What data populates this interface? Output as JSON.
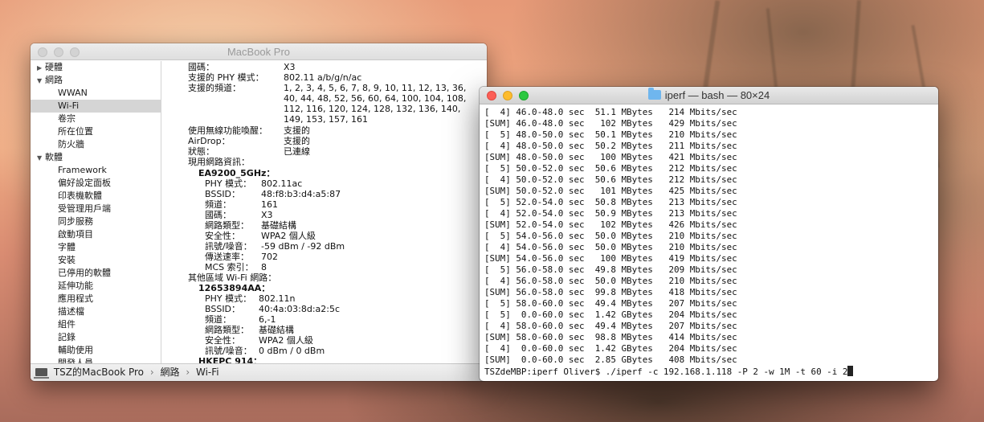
{
  "sysinfo": {
    "title": "MacBook Pro",
    "sidebar": [
      {
        "label": "硬體",
        "level": 0,
        "disclosure": "▶"
      },
      {
        "label": "網路",
        "level": 0,
        "disclosure": "▼"
      },
      {
        "label": "WWAN",
        "level": 1
      },
      {
        "label": "Wi-Fi",
        "level": 1,
        "selected": true
      },
      {
        "label": "卷宗",
        "level": 1
      },
      {
        "label": "所在位置",
        "level": 1
      },
      {
        "label": "防火牆",
        "level": 1
      },
      {
        "label": "軟體",
        "level": 0,
        "disclosure": "▼"
      },
      {
        "label": "Framework",
        "level": 1
      },
      {
        "label": "偏好設定面板",
        "level": 1
      },
      {
        "label": "印表機軟體",
        "level": 1
      },
      {
        "label": "受管理用戶端",
        "level": 1
      },
      {
        "label": "同步服務",
        "level": 1
      },
      {
        "label": "啟動項目",
        "level": 1
      },
      {
        "label": "字體",
        "level": 1
      },
      {
        "label": "安裝",
        "level": 1
      },
      {
        "label": "已停用的軟體",
        "level": 1
      },
      {
        "label": "延伸功能",
        "level": 1
      },
      {
        "label": "應用程式",
        "level": 1
      },
      {
        "label": "描述檔",
        "level": 1
      },
      {
        "label": "組件",
        "level": 1
      },
      {
        "label": "記錄",
        "level": 1
      },
      {
        "label": "輔助使用",
        "level": 1
      },
      {
        "label": "開發人員",
        "level": 1
      }
    ],
    "details": {
      "country_label": "國碼：",
      "country_value": "X3",
      "phy_support_label": "支援的 PHY 模式：",
      "phy_support_value": "802.11 a/b/g/n/ac",
      "channels_label": "支援的頻道：",
      "channels_value": "1, 2, 3, 4, 5, 6, 7, 8, 9, 10, 11, 12, 13, 36, 40, 44, 48, 52, 56, 60, 64, 100, 104, 108, 112, 116, 120, 124, 128, 132, 136, 140, 149, 153, 157, 161",
      "wake_label": "使用無線功能喚醒：",
      "wake_value": "支援的",
      "airdrop_label": "AirDrop：",
      "airdrop_value": "支援的",
      "status_label": "狀態：",
      "status_value": "已連線",
      "current_network_label": "現用網路資訊：",
      "current_network": {
        "name": "EA9200_5GHz：",
        "rows": [
          {
            "k": "PHY 模式：",
            "v": "802.11ac"
          },
          {
            "k": "BSSID：",
            "v": "48:f8:b3:d4:a5:87"
          },
          {
            "k": "頻道：",
            "v": "161"
          },
          {
            "k": "國碼：",
            "v": "X3"
          },
          {
            "k": "網路類型：",
            "v": "基礎結構"
          },
          {
            "k": "安全性：",
            "v": "WPA2 個人級"
          },
          {
            "k": "訊號/噪音：",
            "v": "-59 dBm / -92 dBm"
          },
          {
            "k": "傳送速率：",
            "v": "702"
          },
          {
            "k": "MCS 索引：",
            "v": "8"
          }
        ]
      },
      "other_networks_label": "其他區域 Wi-Fi 網路：",
      "other_network_1": {
        "name": "12653894AA：",
        "rows": [
          {
            "k": "PHY 模式：",
            "v": "802.11n"
          },
          {
            "k": "BSSID：",
            "v": "40:4a:03:8d:a2:5c"
          },
          {
            "k": "頻道：",
            "v": "6,-1"
          },
          {
            "k": "網路類型：",
            "v": "基礎結構"
          },
          {
            "k": "安全性：",
            "v": "WPA2 個人級"
          },
          {
            "k": "訊號/噪音：",
            "v": "0 dBm / 0 dBm"
          }
        ]
      },
      "other_network_2_name": "HKEPC 914："
    },
    "path": {
      "computer": "TSZ的MacBook Pro",
      "section": "網路",
      "item": "Wi-Fi",
      "separator": "›"
    }
  },
  "terminal": {
    "title": "iperf — bash — 80×24",
    "lines": [
      "[  4] 46.0-48.0 sec  51.1 MBytes   214 Mbits/sec",
      "[SUM] 46.0-48.0 sec   102 MBytes   429 Mbits/sec",
      "[  5] 48.0-50.0 sec  50.1 MBytes   210 Mbits/sec",
      "[  4] 48.0-50.0 sec  50.2 MBytes   211 Mbits/sec",
      "[SUM] 48.0-50.0 sec   100 MBytes   421 Mbits/sec",
      "[  5] 50.0-52.0 sec  50.6 MBytes   212 Mbits/sec",
      "[  4] 50.0-52.0 sec  50.6 MBytes   212 Mbits/sec",
      "[SUM] 50.0-52.0 sec   101 MBytes   425 Mbits/sec",
      "[  5] 52.0-54.0 sec  50.8 MBytes   213 Mbits/sec",
      "[  4] 52.0-54.0 sec  50.9 MBytes   213 Mbits/sec",
      "[SUM] 52.0-54.0 sec   102 MBytes   426 Mbits/sec",
      "[  5] 54.0-56.0 sec  50.0 MBytes   210 Mbits/sec",
      "[  4] 54.0-56.0 sec  50.0 MBytes   210 Mbits/sec",
      "[SUM] 54.0-56.0 sec   100 MBytes   419 Mbits/sec",
      "[  5] 56.0-58.0 sec  49.8 MBytes   209 Mbits/sec",
      "[  4] 56.0-58.0 sec  50.0 MBytes   210 Mbits/sec",
      "[SUM] 56.0-58.0 sec  99.8 MBytes   418 Mbits/sec",
      "[  5] 58.0-60.0 sec  49.4 MBytes   207 Mbits/sec",
      "[  5]  0.0-60.0 sec  1.42 GBytes   204 Mbits/sec",
      "[  4] 58.0-60.0 sec  49.4 MBytes   207 Mbits/sec",
      "[SUM] 58.0-60.0 sec  98.8 MBytes   414 Mbits/sec",
      "[  4]  0.0-60.0 sec  1.42 GBytes   204 Mbits/sec",
      "[SUM]  0.0-60.0 sec  2.85 GBytes   408 Mbits/sec"
    ],
    "prompt": "TSZdeMBP:iperf Oliver$ ./iperf -c 192.168.1.118 -P 2 -w 1M -t 60 -i 2"
  }
}
